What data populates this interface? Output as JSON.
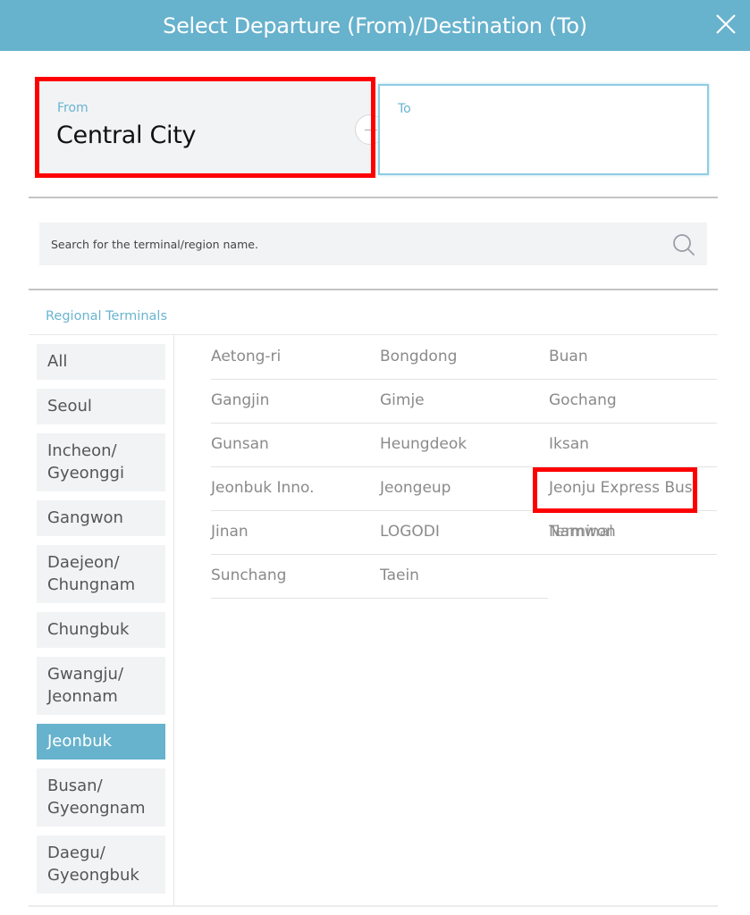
{
  "header": {
    "title": "Select Departure (From)/Destination (To)",
    "close_icon": "close-icon"
  },
  "from": {
    "label": "From",
    "value": "Central City"
  },
  "to": {
    "label": "To",
    "value": ""
  },
  "swap_icon": "swap-icon",
  "search": {
    "placeholder": "Search for the terminal/region name.",
    "value": "",
    "icon": "search-icon"
  },
  "section": {
    "title": "Regional Terminals"
  },
  "regions": [
    {
      "label": "All",
      "active": false
    },
    {
      "label": "Seoul",
      "active": false
    },
    {
      "label": "Incheon/\nGyeonggi",
      "active": false
    },
    {
      "label": "Gangwon",
      "active": false
    },
    {
      "label": "Daejeon/\nChungnam",
      "active": false
    },
    {
      "label": "Chungbuk",
      "active": false
    },
    {
      "label": "Gwangju/\nJeonnam",
      "active": false
    },
    {
      "label": "Jeonbuk",
      "active": true
    },
    {
      "label": "Busan/\nGyeongnam",
      "active": false
    },
    {
      "label": "Daegu/\nGyeongbuk",
      "active": false
    }
  ],
  "terminals": [
    [
      "Aetong-ri",
      "Bongdong",
      "Buan"
    ],
    [
      "Gangjin",
      "Gimje",
      "Gochang"
    ],
    [
      "Gunsan",
      "Heungdeok",
      "Iksan"
    ],
    [
      "Jeonbuk Inno.",
      "Jeongeup",
      "Jeonju Express Bus"
    ],
    [
      "Jinan",
      "LOGODI",
      "Namwon"
    ],
    [
      "Sunchang",
      "Taein"
    ]
  ],
  "overflow_text": "Terminal",
  "colors": {
    "accent": "#67b2cd",
    "highlight": "#ff0000",
    "panel_bg": "#f2f3f5"
  }
}
